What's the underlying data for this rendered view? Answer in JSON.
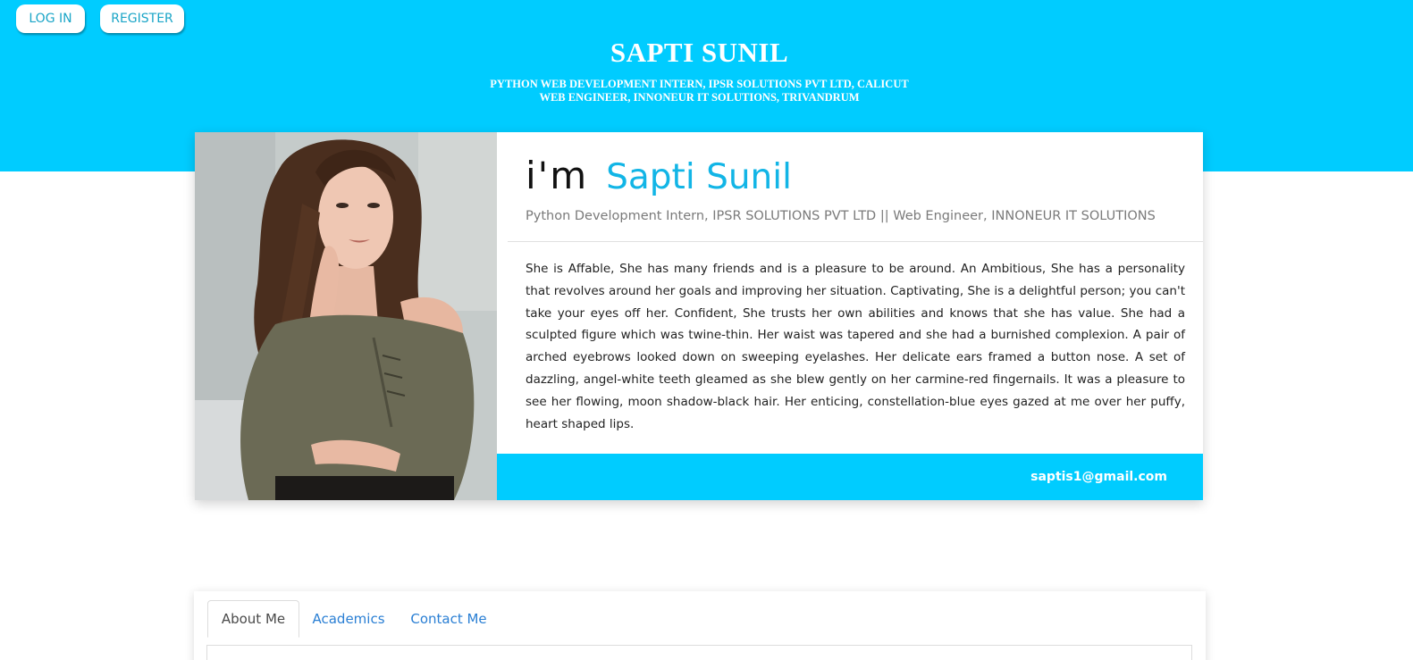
{
  "header": {
    "login_label": "LOG IN",
    "register_label": "REGISTER",
    "title": "SAPTI SUNIL",
    "subtitle_line1": "PYTHON WEB DEVELOPMENT INTERN, IPSR SOLUTIONS PVT LTD, CALICUT",
    "subtitle_line2": "WEB ENGINEER, INNONEUR IT SOLUTIONS, TRIVANDRUM"
  },
  "profile": {
    "greeting": "i'm",
    "name": "Sapti Sunil",
    "roles": "Python Development Intern, IPSR SOLUTIONS PVT LTD || Web Engineer, INNONEUR IT SOLUTIONS",
    "bio": "She is Affable, She has many friends and is a pleasure to be around. An Ambitious, She has a personality that revolves around her goals and improving her situation. Captivating, She is a delightful person; you can't take your eyes off her. Confident, She trusts her own abilities and knows that she has value. She had a sculpted figure which was twine-thin. Her waist was tapered and she had a burnished complexion. A pair of arched eyebrows looked down on sweeping eyelashes. Her delicate ears framed a button nose. A set of dazzling, angel-white teeth gleamed as she blew gently on her carmine-red fingernails. It was a pleasure to see her flowing, moon shadow-black hair. Her enticing, constellation-blue eyes gazed at me over her puffy, heart shaped lips.",
    "email": "saptis1@gmail.com"
  },
  "tabs": [
    {
      "label": "About Me",
      "active": true
    },
    {
      "label": "Academics",
      "active": false
    },
    {
      "label": "Contact Me",
      "active": false
    }
  ],
  "colors": {
    "accent": "#00ccff",
    "name_blue": "#12b5e6",
    "tab_link": "#2a7fd4"
  }
}
